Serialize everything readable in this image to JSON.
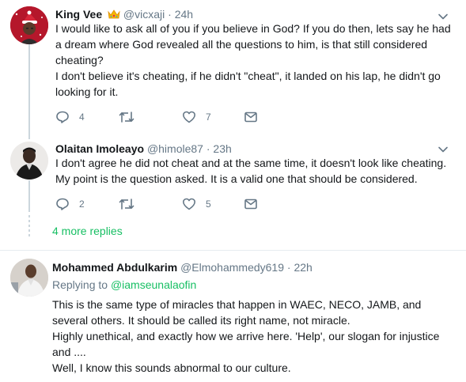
{
  "tweets": [
    {
      "name": "King Vee",
      "badge": "👑",
      "handle": "@vicxaji",
      "sep": "·",
      "time": "24h",
      "lines": [
        "I would like to ask all of you if you believe in God? If you do then, lets say he had a dream where God revealed all the questions to him, is that still considered cheating?",
        "I don't believe it's cheating, if he didn't \"cheat\", it landed on his lap, he didn't go looking for it."
      ],
      "replies": "4",
      "retweets": "",
      "likes": "7"
    },
    {
      "name": "Olaitan Imoleayo",
      "handle": "@himole87",
      "sep": "·",
      "time": "23h",
      "lines": [
        "I don't agree he did not cheat and at the same time, it doesn't look like cheating. My point is the question asked. It is a valid one that should be considered."
      ],
      "replies": "2",
      "retweets": "",
      "likes": "5"
    },
    {
      "name": "Mohammed Abdulkarim",
      "handle": "@Elmohammedy619",
      "sep": "·",
      "time": "22h",
      "replying_prefix": "Replying to",
      "replying_mention": "@iamseunalaofin",
      "lines": [
        "This is the same type of miracles that happen in WAEC, NECO, JAMB, and several others. It should be called its right name, not miracle.",
        "Highly unethical, and exactly how we arrive here. 'Help', our slogan for injustice and ....",
        "Well, I know this sounds abnormal to our culture."
      ]
    }
  ],
  "more_replies": "4 more replies",
  "colors": {
    "accent": "#17bf63",
    "muted": "#657786",
    "thread_line": "#ccd6dd",
    "badge_red": "#e0245e"
  }
}
